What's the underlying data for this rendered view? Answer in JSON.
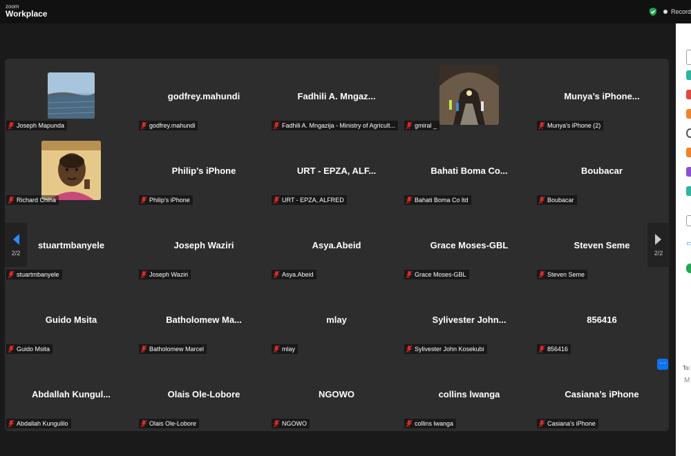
{
  "app": {
    "brand_top": "zoom",
    "brand_main": "Workplace",
    "recording_label": "Recordi"
  },
  "nav": {
    "page_left": "2/2",
    "page_right": "2/2"
  },
  "side_panel": {
    "to_label": "To:",
    "message_initial": "M"
  },
  "colors": {
    "accent": "#0e72ed",
    "muted_red": "#e02828",
    "panel": "#2d2d2d",
    "secure_green": "#23a650"
  },
  "participants": [
    {
      "display": "",
      "label": "Joseph Mapunda",
      "avatar": "lake-photo"
    },
    {
      "display": "godfrey.mahundi",
      "label": "godfrey.mahundi"
    },
    {
      "display": "Fadhili A. Mngaz...",
      "label": "Fadhili A. Mngazija - Ministry of Agricult..."
    },
    {
      "display": "",
      "label": "gmiral _",
      "avatar": "tunnel-photo"
    },
    {
      "display": "Munya’s iPhone...",
      "label": "Munya's iPhone (2)"
    },
    {
      "display": "",
      "label": "Richard Chiha",
      "avatar": "child-photo"
    },
    {
      "display": "Philip’s iPhone",
      "label": "Philip's iPhone"
    },
    {
      "display": "URT - EPZA, ALF...",
      "label": "URT - EPZA, ALFRED"
    },
    {
      "display": "Bahati Boma Co...",
      "label": "Bahati Boma Co ltd"
    },
    {
      "display": "Boubacar",
      "label": "Boubacar"
    },
    {
      "display": "stuartmbanyele",
      "label": "stuartmbanyele"
    },
    {
      "display": "Joseph Waziri",
      "label": "Joseph Waziri"
    },
    {
      "display": "Asya.Abeid",
      "label": "Asya.Abeid"
    },
    {
      "display": "Grace Moses-GBL",
      "label": "Grace Moses-GBL"
    },
    {
      "display": "Steven Seme",
      "label": "Steven Seme"
    },
    {
      "display": "Guido Msita",
      "label": "Guido Msita"
    },
    {
      "display": "Batholomew Ma...",
      "label": "Batholomew Marcel"
    },
    {
      "display": "mlay",
      "label": "mlay"
    },
    {
      "display": "Sylivester John...",
      "label": "Sylivester John Kosekubi"
    },
    {
      "display": "856416",
      "label": "856416"
    },
    {
      "display": "Abdallah Kungul...",
      "label": "Abdallah Kungulilo"
    },
    {
      "display": "Olais Ole-Lobore",
      "label": "Olais Ole-Lobore"
    },
    {
      "display": "NGOWO",
      "label": "NGOWO"
    },
    {
      "display": "collins lwanga",
      "label": "collins lwanga"
    },
    {
      "display": "Casiana’s iPhone",
      "label": "Casiana's iPhone"
    }
  ]
}
